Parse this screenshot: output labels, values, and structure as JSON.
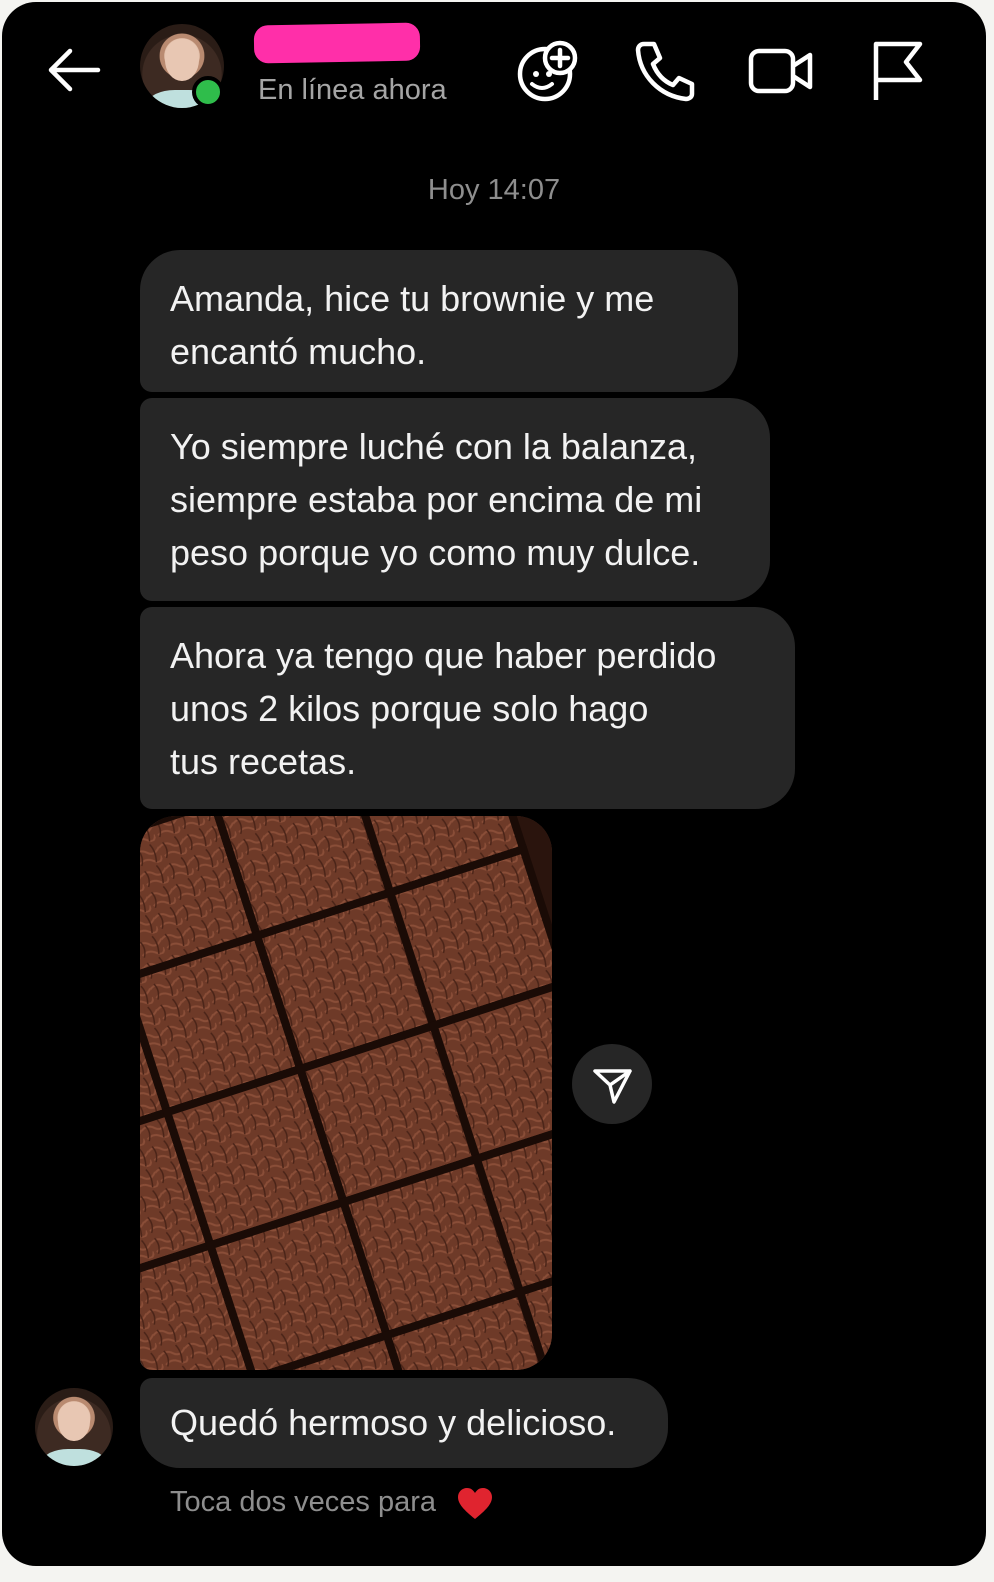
{
  "header": {
    "contact_name_redacted": "",
    "status": "En línea ahora",
    "icons": [
      "back-arrow-icon",
      "effects-icon",
      "phone-icon",
      "video-icon",
      "flag-icon"
    ]
  },
  "chat": {
    "timestamp": "Hoy 14:07",
    "messages": [
      {
        "text": "Amanda, hice tu brownie y me\nencantó mucho."
      },
      {
        "text": "Yo siempre luché con la balanza,\nsiempre estaba por encima de mi\npeso porque yo como muy dulce."
      },
      {
        "text": "Ahora ya tengo que haber perdido\nunos 2 kilos porque solo hago\ntus recetas."
      },
      {
        "text": "Quedó hermoso y delicioso."
      }
    ],
    "hint": "Toca dos veces para"
  },
  "colors": {
    "background": "#000000",
    "bubble": "#262626",
    "online": "#2fbd4b",
    "redaction": "#ff2fa9",
    "heart": "#e0242f"
  }
}
